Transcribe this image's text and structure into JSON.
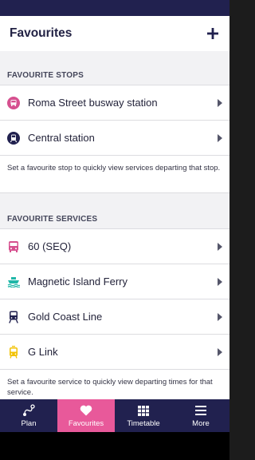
{
  "header": {
    "title": "Favourites",
    "add_icon": "plus-icon"
  },
  "stops": {
    "section_title": "FAVOURITE STOPS",
    "items": [
      {
        "label": "Roma Street busway station",
        "icon": "bus-stop-icon",
        "color": "#d6508f"
      },
      {
        "label": "Central station",
        "icon": "train-stop-icon",
        "color": "#21214f"
      }
    ],
    "note": "Set a favourite stop to quickly view services departing that stop."
  },
  "services": {
    "section_title": "FAVOURITE SERVICES",
    "items": [
      {
        "label": "60 (SEQ)",
        "icon": "bus-icon",
        "color": "#d6508f"
      },
      {
        "label": "Magnetic Island Ferry",
        "icon": "ferry-icon",
        "color": "#1fb7a8"
      },
      {
        "label": "Gold Coast Line",
        "icon": "train-icon",
        "color": "#21214f"
      },
      {
        "label": "G Link",
        "icon": "tram-icon",
        "color": "#f2c200"
      }
    ],
    "note": "Set a favourite service to quickly view departing times for that service."
  },
  "tabs": [
    {
      "label": "Plan",
      "icon": "route-icon",
      "active": false
    },
    {
      "label": "Favourites",
      "icon": "heart-icon",
      "active": true
    },
    {
      "label": "Timetable",
      "icon": "grid-icon",
      "active": false
    },
    {
      "label": "More",
      "icon": "menu-icon",
      "active": false
    }
  ],
  "colors": {
    "navy": "#21214f",
    "accent": "#e8599a",
    "background": "#f2f2f4"
  }
}
